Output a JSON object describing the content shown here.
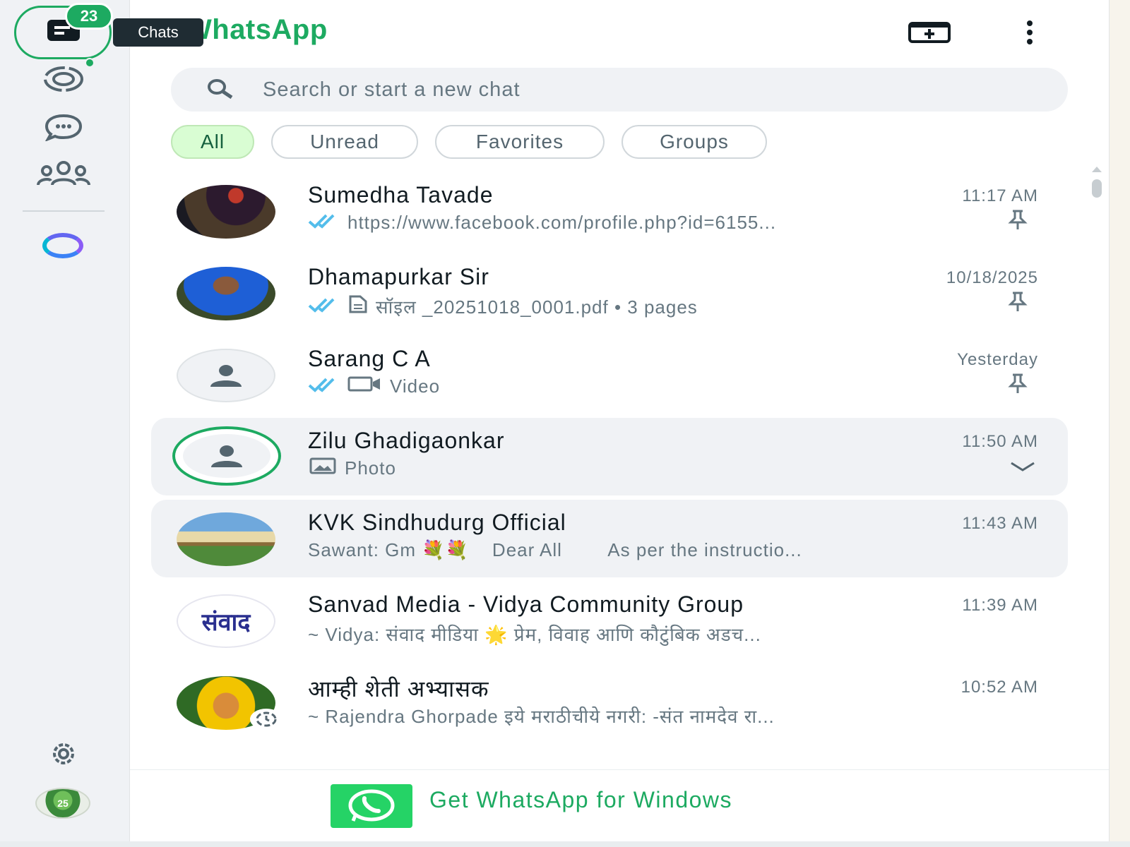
{
  "app": {
    "title": "WhatsApp"
  },
  "rail": {
    "chats_badge": "23",
    "chats_tooltip": "Chats",
    "items": [
      {
        "icon": "chats-icon"
      },
      {
        "icon": "status-icon"
      },
      {
        "icon": "channels-icon"
      },
      {
        "icon": "communities-icon"
      },
      {
        "icon": "meta-ai-icon"
      },
      {
        "icon": "settings-icon"
      },
      {
        "icon": "profile-avatar"
      }
    ],
    "profile_text": "25"
  },
  "header": {
    "new_chat_icon": "new-chat-icon",
    "menu_icon": "menu-icon"
  },
  "search": {
    "placeholder": "Search or start a new chat"
  },
  "filters": [
    {
      "label": "All",
      "active": true
    },
    {
      "label": "Unread",
      "active": false
    },
    {
      "label": "Favorites",
      "active": false
    },
    {
      "label": "Groups",
      "active": false
    }
  ],
  "chats": [
    {
      "name": "Sumedha Tavade",
      "time": "11:17 AM",
      "preview": "https://www.facebook.com/profile.php?id=6155...",
      "pinned": true
    },
    {
      "name": "Dhamapurkar Sir",
      "time": "10/18/2025",
      "preview": "सॉइल _20251018_0001.pdf • 3 pages",
      "pinned": true
    },
    {
      "name": "Sarang C A",
      "time": "Yesterday",
      "preview": "Video",
      "pinned": true
    },
    {
      "name": "Zilu Ghadigaonkar",
      "time": "11:50 AM",
      "preview": "Photo",
      "pinned": false
    },
    {
      "name": "KVK Sindhudurg Official",
      "time": "11:43 AM",
      "preview": "Sawant: Gm 💐💐    Dear All        As per the instructio...",
      "pinned": false
    },
    {
      "name": "Sanvad Media - Vidya Community Group",
      "time": "11:39 AM",
      "preview": "~ Vidya: संवाद मीडिया 🌟 प्रेम, विवाह आणि कौटुंबिक अडच...",
      "pinned": false,
      "avatar_text": "संवाद"
    },
    {
      "name": "आम्ही शेती अभ्यासक",
      "time": "10:52 AM",
      "preview": "~ Rajendra Ghorpade इये मराठीचीये नगरी: -संत नामदेव रा...",
      "pinned": false
    }
  ],
  "footer": {
    "text": "Get WhatsApp for Windows"
  },
  "colors": {
    "accent": "#1daa61",
    "ticks": "#53bdeb",
    "chip_active_bg": "#d9fdd3"
  }
}
